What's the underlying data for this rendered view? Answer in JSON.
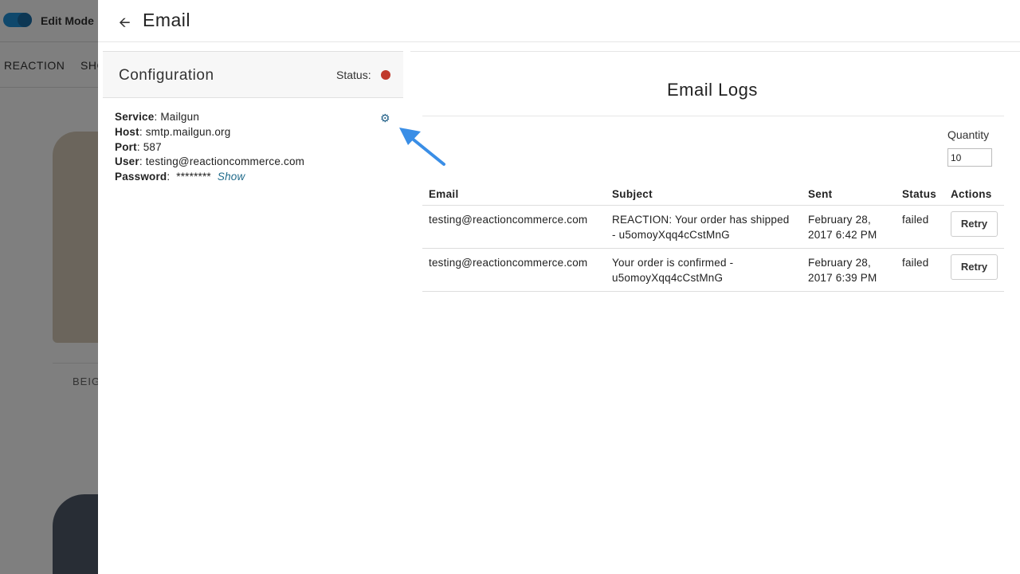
{
  "background": {
    "edit_mode_label": "Edit Mode",
    "nav_items": [
      "REACTION",
      "SHO"
    ],
    "product_label": "BEIG"
  },
  "panel": {
    "title": "Email",
    "back_icon": "arrow-left-icon"
  },
  "configuration": {
    "title": "Configuration",
    "status_label": "Status:",
    "status_color": "#c0392b",
    "fields": {
      "service_label": "Service",
      "service_value": "Mailgun",
      "host_label": "Host",
      "host_value": "smtp.mailgun.org",
      "port_label": "Port",
      "port_value": "587",
      "user_label": "User",
      "user_value": "testing@reactioncommerce.com",
      "password_label": "Password",
      "password_value": "********",
      "show_link": "Show"
    },
    "settings_icon": "gear-icon"
  },
  "email_logs": {
    "title": "Email Logs",
    "quantity_label": "Quantity",
    "quantity_value": "10",
    "columns": [
      "Email",
      "Subject",
      "Sent",
      "Status",
      "Actions"
    ],
    "rows": [
      {
        "email": "testing@reactioncommerce.com",
        "subject": "REACTION: Your order has shipped - u5omoyXqq4cCstMnG",
        "sent": "February 28, 2017 6:42 PM",
        "status": "failed",
        "action": "Retry"
      },
      {
        "email": "testing@reactioncommerce.com",
        "subject": "Your order is confirmed - u5omoyXqq4cCstMnG",
        "sent": "February 28, 2017 6:39 PM",
        "status": "failed",
        "action": "Retry"
      }
    ]
  },
  "colors": {
    "accent": "#1f90d8",
    "annotation_arrow": "#3a8ee6",
    "status_failed": "#c0392b"
  }
}
